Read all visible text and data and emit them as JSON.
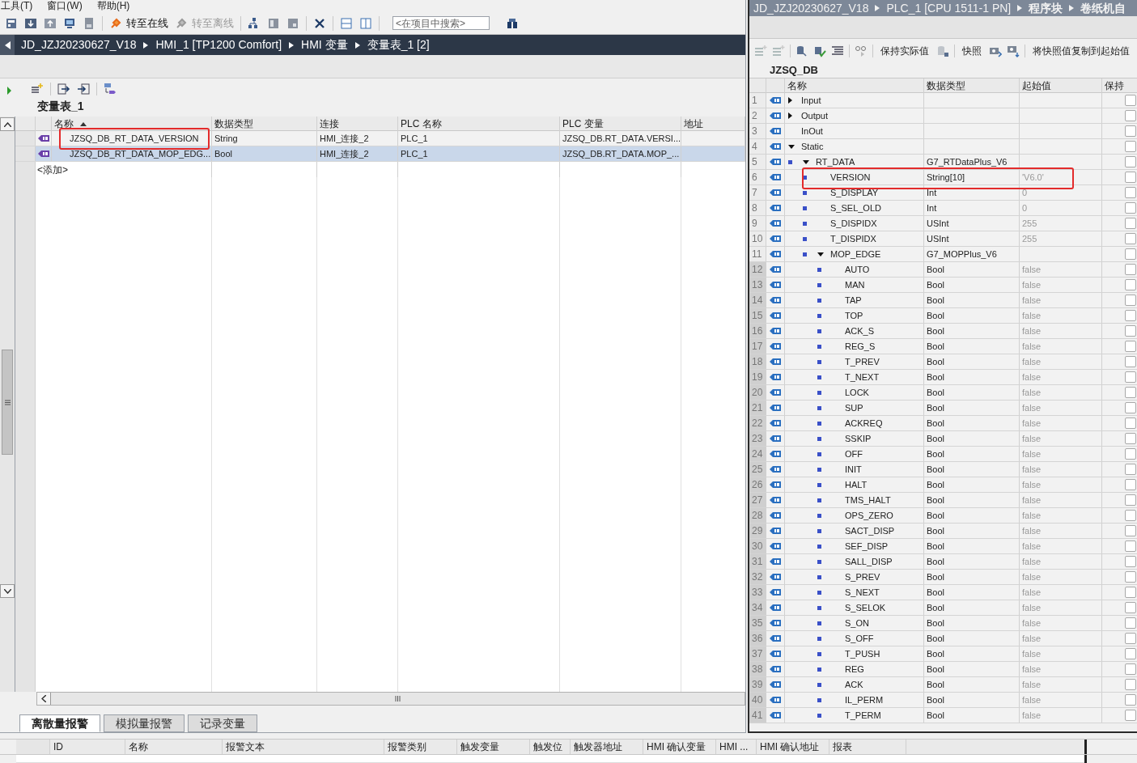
{
  "menu": [
    "工具(T)",
    "窗口(W)",
    "帮助(H)"
  ],
  "toolbar_actions": [
    {
      "label": "转至在线",
      "disabled": false
    },
    {
      "label": "转至离线",
      "disabled": true
    }
  ],
  "search": {
    "placeholder": "<在项目中搜索>"
  },
  "breadcrumb": [
    "JD_JZJ20230627_V18",
    "HMI_1 [TP1200 Comfort]",
    "HMI 变量",
    "变量表_1 [2]"
  ],
  "tag_table": {
    "title": "变量表_1",
    "columns": [
      "名称",
      "数据类型",
      "连接",
      "PLC 名称",
      "PLC 变量",
      "地址"
    ],
    "rows": [
      {
        "name": "JZSQ_DB_RT_DATA_VERSION",
        "data_type": "String",
        "connection": "HMI_连接_2",
        "plc_name": "PLC_1",
        "plc_tag": "JZSQ_DB.RT_DATA.VERSI...",
        "selected": false,
        "highlighted": true
      },
      {
        "name": "JZSQ_DB_RT_DATA_MOP_EDG...",
        "data_type": "Bool",
        "connection": "HMI_连接_2",
        "plc_name": "PLC_1",
        "plc_tag": "JZSQ_DB.RT_DATA.MOP_...",
        "selected": true,
        "highlighted": false
      }
    ],
    "add_row": "<添加>"
  },
  "alarm_tabs": [
    {
      "label": "离散量报警",
      "selected": true
    },
    {
      "label": "模拟量报警",
      "selected": false
    },
    {
      "label": "记录变量",
      "selected": false
    }
  ],
  "alarm_table": {
    "columns": [
      "ID",
      "名称",
      "报警文本",
      "报警类别",
      "触发变量",
      "触发位",
      "触发器地址",
      "HMI 确认变量",
      "HMI ...",
      "HMI 确认地址",
      "报表"
    ]
  },
  "db_editor": {
    "breadcrumb": [
      "JD_JZJ20230627_V18",
      "PLC_1 [CPU 1511-1 PN]",
      "程序块",
      "卷纸机自"
    ],
    "toolbar_labels": [
      "保持实际值",
      "快照",
      "将快照值复制到起始值"
    ],
    "title": "JZSQ_DB",
    "columns": [
      "名称",
      "数据类型",
      "起始值",
      "保持"
    ],
    "rows": [
      {
        "no": "1",
        "name": "Input",
        "expanded": false,
        "retain": false,
        "selected": false
      },
      {
        "no": "2",
        "name": "Output",
        "expanded": false,
        "retain": false,
        "selected": false
      },
      {
        "no": "3",
        "name": "InOut",
        "retain": false,
        "selected": false
      },
      {
        "no": "4",
        "name": "Static",
        "expanded": true,
        "retain": false,
        "selected": false,
        "children": [
          {
            "no": "5",
            "name": "RT_DATA",
            "type": "G7_RTDataPlus_V6",
            "expanded": true,
            "retain": false,
            "selected": false,
            "children": [
              {
                "no": "6",
                "name": "VERSION",
                "type": "String[10]",
                "start": "'V6.0'",
                "retain": false,
                "selected": false,
                "highlighted": true
              },
              {
                "no": "7",
                "name": "S_DISPLAY",
                "type": "Int",
                "start": "0",
                "retain": false,
                "selected": false
              },
              {
                "no": "8",
                "name": "S_SEL_OLD",
                "type": "Int",
                "start": "0",
                "retain": false,
                "selected": false
              },
              {
                "no": "9",
                "name": "S_DISPIDX",
                "type": "USInt",
                "start": "255",
                "retain": false,
                "selected": false
              },
              {
                "no": "10",
                "name": "T_DISPIDX",
                "type": "USInt",
                "start": "255",
                "retain": false,
                "selected": false
              },
              {
                "no": "11",
                "name": "MOP_EDGE",
                "type": "G7_MOPPlus_V6",
                "expanded": true,
                "retain": false,
                "selected": false,
                "children": [
                  {
                    "no": "12",
                    "name": "AUTO",
                    "type": "Bool",
                    "start": "false",
                    "retain": false,
                    "selected": true
                  },
                  {
                    "no": "13",
                    "name": "MAN",
                    "type": "Bool",
                    "start": "false",
                    "retain": false,
                    "selected": true
                  },
                  {
                    "no": "14",
                    "name": "TAP",
                    "type": "Bool",
                    "start": "false",
                    "retain": false,
                    "selected": true
                  },
                  {
                    "no": "15",
                    "name": "TOP",
                    "type": "Bool",
                    "start": "false",
                    "retain": false,
                    "selected": true
                  },
                  {
                    "no": "16",
                    "name": "ACK_S",
                    "type": "Bool",
                    "start": "false",
                    "retain": false,
                    "selected": true
                  },
                  {
                    "no": "17",
                    "name": "REG_S",
                    "type": "Bool",
                    "start": "false",
                    "retain": false,
                    "selected": true
                  },
                  {
                    "no": "18",
                    "name": "T_PREV",
                    "type": "Bool",
                    "start": "false",
                    "retain": false,
                    "selected": true
                  },
                  {
                    "no": "19",
                    "name": "T_NEXT",
                    "type": "Bool",
                    "start": "false",
                    "retain": false,
                    "selected": true
                  },
                  {
                    "no": "20",
                    "name": "LOCK",
                    "type": "Bool",
                    "start": "false",
                    "retain": false,
                    "selected": true
                  },
                  {
                    "no": "21",
                    "name": "SUP",
                    "type": "Bool",
                    "start": "false",
                    "retain": false,
                    "selected": true
                  },
                  {
                    "no": "22",
                    "name": "ACKREQ",
                    "type": "Bool",
                    "start": "false",
                    "retain": false,
                    "selected": true
                  },
                  {
                    "no": "23",
                    "name": "SSKIP",
                    "type": "Bool",
                    "start": "false",
                    "retain": false,
                    "selected": true
                  },
                  {
                    "no": "24",
                    "name": "OFF",
                    "type": "Bool",
                    "start": "false",
                    "retain": false,
                    "selected": true
                  },
                  {
                    "no": "25",
                    "name": "INIT",
                    "type": "Bool",
                    "start": "false",
                    "retain": false,
                    "selected": true
                  },
                  {
                    "no": "26",
                    "name": "HALT",
                    "type": "Bool",
                    "start": "false",
                    "retain": false,
                    "selected": true
                  },
                  {
                    "no": "27",
                    "name": "TMS_HALT",
                    "type": "Bool",
                    "start": "false",
                    "retain": false,
                    "selected": true
                  },
                  {
                    "no": "28",
                    "name": "OPS_ZERO",
                    "type": "Bool",
                    "start": "false",
                    "retain": false,
                    "selected": true
                  },
                  {
                    "no": "29",
                    "name": "SACT_DISP",
                    "type": "Bool",
                    "start": "false",
                    "retain": false,
                    "selected": true
                  },
                  {
                    "no": "30",
                    "name": "SEF_DISP",
                    "type": "Bool",
                    "start": "false",
                    "retain": false,
                    "selected": true
                  },
                  {
                    "no": "31",
                    "name": "SALL_DISP",
                    "type": "Bool",
                    "start": "false",
                    "retain": false,
                    "selected": true
                  },
                  {
                    "no": "32",
                    "name": "S_PREV",
                    "type": "Bool",
                    "start": "false",
                    "retain": false,
                    "selected": true
                  },
                  {
                    "no": "33",
                    "name": "S_NEXT",
                    "type": "Bool",
                    "start": "false",
                    "retain": false,
                    "selected": true
                  },
                  {
                    "no": "34",
                    "name": "S_SELOK",
                    "type": "Bool",
                    "start": "false",
                    "retain": false,
                    "selected": true
                  },
                  {
                    "no": "35",
                    "name": "S_ON",
                    "type": "Bool",
                    "start": "false",
                    "retain": false,
                    "selected": true
                  },
                  {
                    "no": "36",
                    "name": "S_OFF",
                    "type": "Bool",
                    "start": "false",
                    "retain": false,
                    "selected": true
                  },
                  {
                    "no": "37",
                    "name": "T_PUSH",
                    "type": "Bool",
                    "start": "false",
                    "retain": false,
                    "selected": true
                  },
                  {
                    "no": "38",
                    "name": "REG",
                    "type": "Bool",
                    "start": "false",
                    "retain": false,
                    "selected": true
                  },
                  {
                    "no": "39",
                    "name": "ACK",
                    "type": "Bool",
                    "start": "false",
                    "retain": false,
                    "selected": true
                  },
                  {
                    "no": "40",
                    "name": "IL_PERM",
                    "type": "Bool",
                    "start": "false",
                    "retain": false,
                    "selected": true
                  },
                  {
                    "no": "41",
                    "name": "T_PERM",
                    "type": "Bool",
                    "start": "false",
                    "retain": false,
                    "selected": true
                  }
                ]
              }
            ]
          }
        ]
      }
    ]
  }
}
